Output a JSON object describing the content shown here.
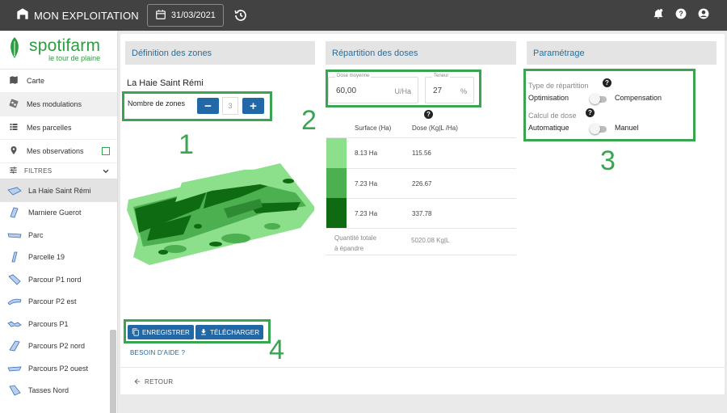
{
  "topbar": {
    "title": "MON EXPLOITATION",
    "date": "31/03/2021",
    "icons": [
      "farm-icon",
      "calendar-icon",
      "history-icon",
      "notification-icon",
      "help-icon",
      "account-icon"
    ]
  },
  "sidebar": {
    "brand": "spotifarm",
    "tagline": "le tour de plaine",
    "menu": [
      {
        "label": "Carte",
        "icon": "map-icon"
      },
      {
        "label": "Mes modulations",
        "icon": "modulation-icon"
      },
      {
        "label": "Mes parcelles",
        "icon": "list-icon"
      },
      {
        "label": "Mes observations",
        "icon": "location-pin-icon"
      }
    ],
    "filters_label": "FILTRES",
    "parcels": [
      "La Haie Saint Rémi",
      "Marniere Guerot",
      "Parc",
      "Parcelle 19",
      "Parcour P1 nord",
      "Parcour P2 est",
      "Parcours P1",
      "Parcours P2 nord",
      "Parcours P2 ouest",
      "Tasses Nord"
    ]
  },
  "zones": {
    "header": "Définition des zones",
    "parcel_name": "La Haie Saint Rémi",
    "zones_label": "Nombre de zones",
    "zones_value": "3",
    "minus": "−",
    "plus": "+",
    "save_label": "ENREGISTRER",
    "download_label": "TÉLÉCHARGER",
    "help_link": "BESOIN D'AIDE ?",
    "back_label": "RETOUR"
  },
  "doses": {
    "header": "Répartition des doses",
    "avg_label": "Dose moyenne",
    "avg_value": "60,00",
    "avg_unit": "U/Ha",
    "content_label": "Teneur",
    "content_value": "27",
    "content_unit": "%",
    "col_surface": "Surface (Ha)",
    "col_dose": "Dose (Kg|L /Ha)",
    "rows": [
      {
        "surface": "8.13 Ha",
        "dose": "115.56",
        "color": "#8ce08c"
      },
      {
        "surface": "7.23 Ha",
        "dose": "226.67",
        "color": "#4caf50"
      },
      {
        "surface": "7.23 Ha",
        "dose": "337.78",
        "color": "#0e6b12"
      }
    ],
    "total_label_1": "Quantité totale",
    "total_label_2": "à épandre",
    "total_value": "5020.08 Kg|L"
  },
  "settings": {
    "header": "Paramétrage",
    "distribution_label": "Type de répartition",
    "distribution_left": "Optimisation",
    "distribution_right": "Compensation",
    "dose_calc_label": "Calcul de dose",
    "dose_calc_left": "Automatique",
    "dose_calc_right": "Manuel"
  },
  "annotations": {
    "n1": "1",
    "n2": "2",
    "n3": "3",
    "n4": "4"
  },
  "colors": {
    "accent_green": "#3aa551",
    "primary_blue": "#2368a6",
    "header_text": "#2a6e9a"
  }
}
